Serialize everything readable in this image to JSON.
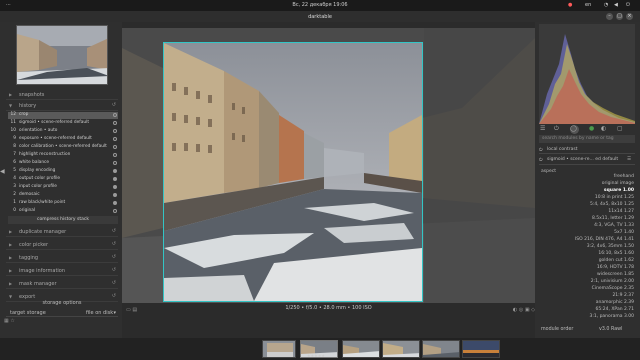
{
  "system": {
    "clock": "Вс, 22 декабря 19:06",
    "lang": "en"
  },
  "app": {
    "title": "darktable"
  },
  "left": {
    "sections_top": [
      {
        "label": "snapshots"
      },
      {
        "label": "history"
      }
    ],
    "history": [
      {
        "n": "12",
        "name": "crop",
        "state": "on"
      },
      {
        "n": "11",
        "name": "sigmoid • scene-referred default",
        "state": "on"
      },
      {
        "n": "10",
        "name": "orientation • auto",
        "state": "on"
      },
      {
        "n": "9",
        "name": "exposure • scene-referred default",
        "state": "on"
      },
      {
        "n": "8",
        "name": "color calibration • scene-referred default",
        "state": "on"
      },
      {
        "n": "7",
        "name": "highlight reconstruction",
        "state": "on"
      },
      {
        "n": "6",
        "name": "white balance",
        "state": "on"
      },
      {
        "n": "5",
        "name": "display encoding",
        "state": "off"
      },
      {
        "n": "4",
        "name": "output color profile",
        "state": "off"
      },
      {
        "n": "3",
        "name": "input color profile",
        "state": "off"
      },
      {
        "n": "2",
        "name": "demosaic",
        "state": "off"
      },
      {
        "n": "1",
        "name": "raw black/white point",
        "state": "off"
      },
      {
        "n": "0",
        "name": "original",
        "state": "on"
      }
    ],
    "compress_label": "compress history stack",
    "sections": [
      {
        "label": "duplicate manager"
      },
      {
        "label": "color picker"
      },
      {
        "label": "tagging"
      },
      {
        "label": "image information"
      },
      {
        "label": "mask manager"
      },
      {
        "label": "export"
      }
    ],
    "storage_options": "storage options",
    "target_storage": "target storage",
    "target_value": "file on disk"
  },
  "center": {
    "info": "1/250 • f/5.0 • 28.0 mm • 100 ISO"
  },
  "right": {
    "search_placeholder": "search modules by name or tag",
    "local_contrast": "local contrast",
    "sigmoid": "sigmoid • scene-re... ed default",
    "aspect_label": "aspect",
    "aspects": [
      "freehand",
      "original image",
      "square 1.00",
      "10:8 in print 1.25",
      "5:4, 4x5, 8x10 1.25",
      "11x14 1.27",
      "8.5x11, letter 1.29",
      "4:3, VGA, TV 1.33",
      "5x7 1.40",
      "ISO 216, DIN 476, A4 1.41",
      "3:2, 4x6, 35mm 1.50",
      "16:10, 8x5 1.60",
      "golden cut 1.62",
      "16:9, HDTV 1.78",
      "widescreen 1.85",
      "2:1, univisium 2.00",
      "CinemaScope 2.35",
      "21:9 2.37",
      "anamorphic 2.39",
      "65:24, XPan 2.71",
      "3:1, panorama 3.00"
    ],
    "module_order": "module order",
    "version": "v3.0 Rawl"
  },
  "colors": {
    "crop_frame": "#33c5c5",
    "active_row": "#5a5a5a"
  }
}
